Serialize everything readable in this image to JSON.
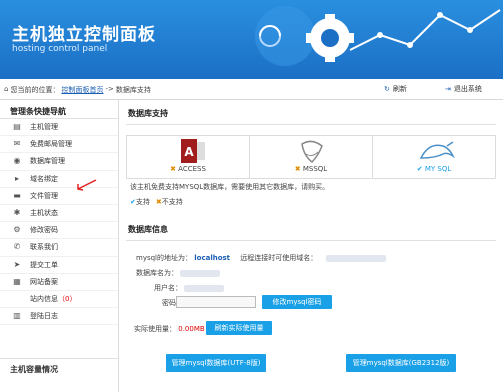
{
  "header": {
    "title": "主机独立控制面板",
    "subtitle": "hosting control panel"
  },
  "crumbs": {
    "prefix": "您当前的位置：",
    "home_link": "控制面板首页",
    "separator": "->",
    "current": "数据库支持",
    "refresh": "刷新",
    "logout": "退出系统"
  },
  "sidebar": {
    "heading": "管理条快捷导航",
    "items": [
      {
        "label": "主机管理",
        "icon": "server-icon"
      },
      {
        "label": "免费邮局管理",
        "icon": "mail-icon"
      },
      {
        "label": "数据库管理",
        "icon": "database-icon"
      },
      {
        "label": "域名绑定",
        "icon": "link-icon"
      },
      {
        "label": "文件管理",
        "icon": "folder-icon"
      },
      {
        "label": "主机状态",
        "icon": "status-icon"
      },
      {
        "label": "修改密码",
        "icon": "key-icon"
      },
      {
        "label": "联系我们",
        "icon": "phone-icon"
      },
      {
        "label": "提交工单",
        "icon": "ticket-icon"
      },
      {
        "label": "网站备案",
        "icon": "record-icon"
      },
      {
        "label": "站内信息",
        "count": "（0）",
        "icon": "message-icon"
      },
      {
        "label": "登陆日志",
        "icon": "log-icon"
      }
    ],
    "footer_heading": "主机容量情况"
  },
  "db_support": {
    "heading": "数据库支持",
    "items": [
      {
        "name": "ACCESS",
        "mark": "✖",
        "mark_color": "#e08a00"
      },
      {
        "name": "MSSQL",
        "mark": "✖",
        "mark_color": "#e08a00"
      },
      {
        "name": "MY SQL",
        "mark": "✔",
        "mark_color": "#1aa0e6"
      }
    ],
    "note": "该主机免费支持MYSQL数据库，需要使用其它数据库，请购买。",
    "legend_supported": "支持",
    "legend_unsupported": "不支持"
  },
  "db_info": {
    "heading": "数据库信息",
    "address_label": "mysql的地址为：",
    "address_value": "localhost",
    "remote_label": "远程连接时可使用域名：",
    "db_name_label": "数据库名为：",
    "user_label": "用户名：",
    "password_label": "密码：",
    "modify_password_button": "修改mysql密码",
    "usage_label": "实际使用量：",
    "usage_value": "0.00MB",
    "refresh_usage_button": "刷新实际使用量",
    "manage_utf8_button": "管理mysql数据库(UTF-8版)",
    "manage_gb2312_button": "管理mysql数据库(GB2312版)"
  }
}
